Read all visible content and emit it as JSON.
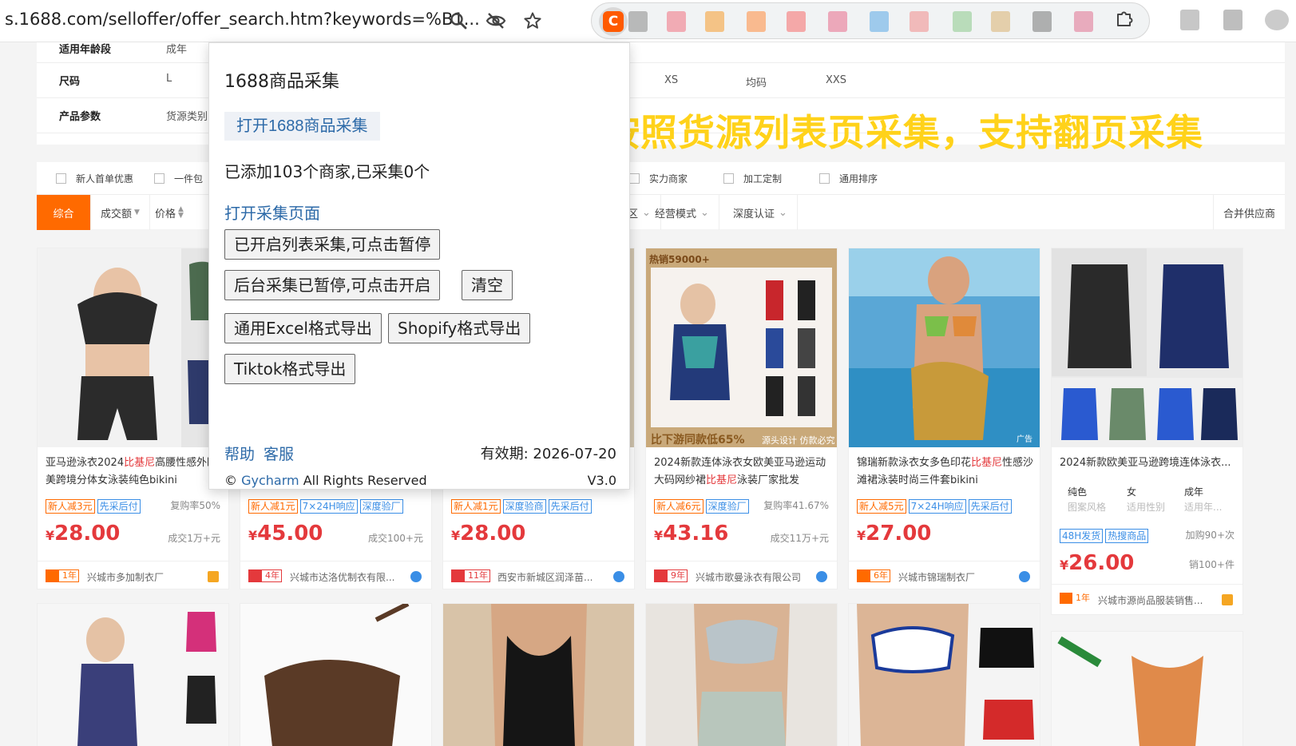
{
  "browser": {
    "url": "s.1688.com/selloffer/offer_search.htm?keywords=%B1..."
  },
  "filters": {
    "rows": [
      {
        "key": "适用年龄段",
        "value": "成年"
      },
      {
        "key": "尺码",
        "value": "L",
        "options": [
          "XS",
          "均码",
          "XXS"
        ]
      },
      {
        "key": "产品参数",
        "value": "货源类别"
      }
    ]
  },
  "checkboxes": [
    "新人首单优惠",
    "一件包",
    "实力商家",
    "加工定制",
    "通用排序"
  ],
  "checkbox_partial": "货",
  "sort": {
    "items": [
      "综合",
      "成交额",
      "价格",
      "区",
      "经营模式",
      "深度认证",
      "合并供应商"
    ]
  },
  "products": [
    {
      "title_a": "亚马逊泳衣2024",
      "title_hl": "比基尼",
      "title_b": "高腰性感外欧美跨境分体女泳装纯色bikini",
      "tags": [
        {
          "t": "新人减3元",
          "c": "o"
        },
        {
          "t": "先采后付",
          "c": "b"
        }
      ],
      "repurchase": "复购率50%",
      "price": "28.00",
      "sales": "成交1万+元",
      "years": "1年",
      "shop": "兴城市多加制衣厂"
    },
    {
      "title_a": "",
      "title_hl": "",
      "title_b": "",
      "tags": [
        {
          "t": "新人减1元",
          "c": "o"
        },
        {
          "t": "7×24H响应",
          "c": "b"
        },
        {
          "t": "深度验厂",
          "c": "b"
        }
      ],
      "repurchase": "",
      "price": "45.00",
      "sales": "成交100+元",
      "years": "4年",
      "shop": "兴城市达洛优制衣有限..."
    },
    {
      "title_a": "",
      "title_hl": "",
      "title_b": "",
      "tags": [
        {
          "t": "新人减1元",
          "c": "o"
        },
        {
          "t": "深度验商",
          "c": "b"
        },
        {
          "t": "先采后付",
          "c": "b"
        }
      ],
      "repurchase": "",
      "price": "28.00",
      "sales": "",
      "years": "11年",
      "shop": "西安市新城区润泽苗..."
    },
    {
      "title_a": "2024新款连体泳衣女欧美亚马逊运动大码网纱裙",
      "title_hl": "比基尼",
      "title_b": "泳装厂家批发",
      "tags": [
        {
          "t": "新人减6元",
          "c": "o"
        },
        {
          "t": "深度验厂",
          "c": "b"
        }
      ],
      "repurchase": "复购率41.67%",
      "price": "43.16",
      "sales": "成交11万+元",
      "years": "9年",
      "shop": "兴城市歌曼泳衣有限公司",
      "img_top": "热销59000+",
      "img_bottom": "比下游同款低65%",
      "img_bottom2": "源头设计 仿款必究"
    },
    {
      "title_a": "锦瑞新款泳衣女多色印花",
      "title_hl": "比基尼",
      "title_b": "性感沙滩裙泳装时尚三件套bikini",
      "tags": [
        {
          "t": "新人减5元",
          "c": "o"
        },
        {
          "t": "7×24H响应",
          "c": "b"
        },
        {
          "t": "先采后付",
          "c": "b"
        }
      ],
      "repurchase": "",
      "price": "27.00",
      "sales": "",
      "years": "6年",
      "shop": "兴城市锦瑞制衣厂",
      "ad": "广告"
    },
    {
      "title_a": "2024新款欧美亚马逊跨境连体泳衣...",
      "title_hl": "",
      "title_b": "",
      "attrs": [
        {
          "k": "纯色",
          "v": "图案风格"
        },
        {
          "k": "女",
          "v": "适用性别"
        },
        {
          "k": "成年",
          "v": "适用年..."
        }
      ],
      "tags": [
        {
          "t": "48H发货",
          "c": "b"
        },
        {
          "t": "热搜商品",
          "c": "b"
        }
      ],
      "repurchase": "加购90+次",
      "price": "26.00",
      "sales": "销100+件",
      "years": "1年",
      "shop": "兴城市源尚品服装销售..."
    }
  ],
  "popup": {
    "title": "1688商品采集",
    "open_button": "打开1688商品采集",
    "status": "已添加103个商家,已采集0个",
    "open_page_link": "打开采集页面",
    "list_collect_button": "已开启列表采集,可点击暂停",
    "bg_collect_button": "后台采集已暂停,可点击开启",
    "clear_button": "清空",
    "excel_button": "通用Excel格式导出",
    "shopify_button": "Shopify格式导出",
    "tiktok_button": "Tiktok格式导出",
    "help_link": "帮助",
    "service_link": "客服",
    "expiry": "有效期: 2026-07-20",
    "copyright_prefix": "©",
    "brand": "Gycharm",
    "copyright_suffix": "All Rights Reserved",
    "version": "V3.0"
  },
  "banner": "支持搜索后按照货源列表页采集，支持翻页采集",
  "colors": {
    "accent": "#ff6a00",
    "price": "#e4393c",
    "link": "#2d6aa8",
    "banner": "#ffd21a"
  }
}
